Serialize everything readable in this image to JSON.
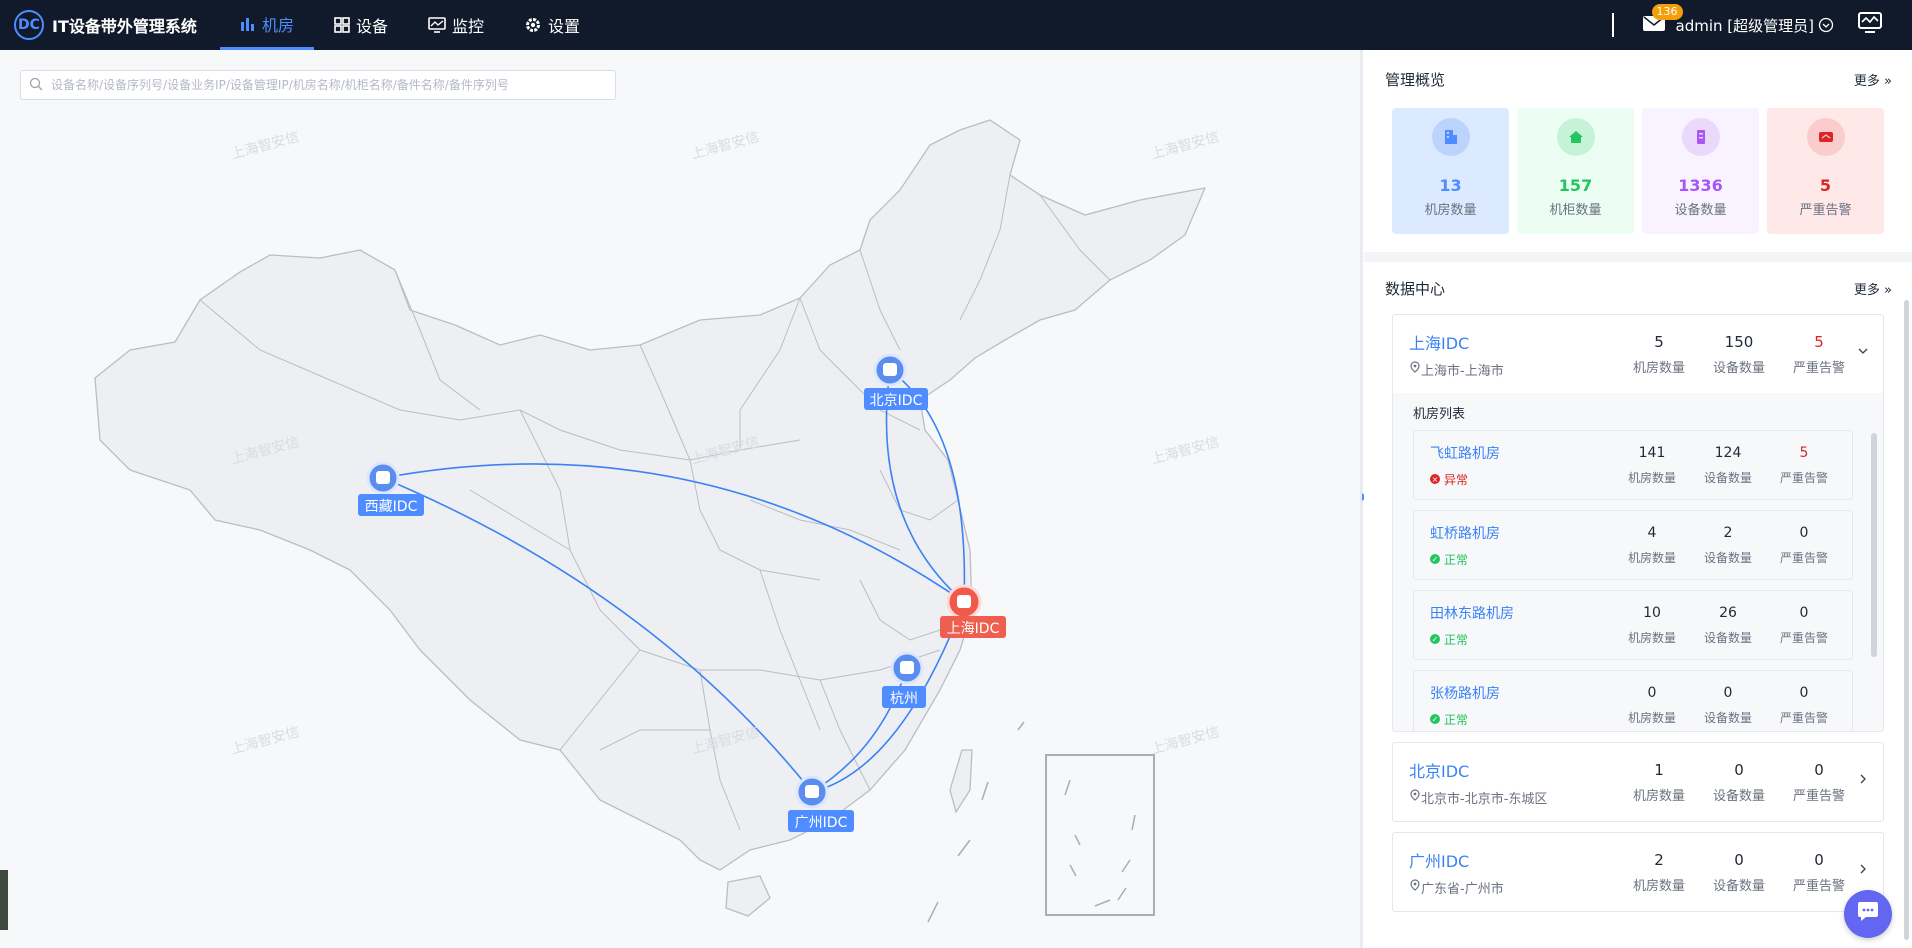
{
  "app": {
    "title": "IT设备带外管理系统",
    "logo_text": "DC"
  },
  "nav": {
    "items": [
      {
        "label": "机房",
        "icon": "bar-chart-icon",
        "active": true
      },
      {
        "label": "设备",
        "icon": "grid-icon",
        "active": false
      },
      {
        "label": "监控",
        "icon": "monitor-icon",
        "active": false
      },
      {
        "label": "设置",
        "icon": "gear-icon",
        "active": false
      }
    ]
  },
  "header": {
    "mail_count": "136",
    "user": "admin [超级管理员]"
  },
  "search": {
    "placeholder": "设备名称/设备序列号/设备业务IP/设备管理IP/机房名称/机柜名称/备件名称/备件序列号"
  },
  "map": {
    "nodes": {
      "beijing": "北京IDC",
      "tibet": "西藏IDC",
      "shanghai": "上海IDC",
      "hangzhou": "杭州",
      "guangzhou": "广州IDC"
    },
    "watermark": "上海智安信"
  },
  "overview": {
    "title": "管理概览",
    "more": "更多",
    "stats": [
      {
        "value": "13",
        "label": "机房数量",
        "color": "#4f8cff",
        "bg": "#dbeafe"
      },
      {
        "value": "157",
        "label": "机柜数量",
        "color": "#22c55e",
        "bg": "#ecfdf3"
      },
      {
        "value": "1336",
        "label": "设备数量",
        "color": "#a855f7",
        "bg": "#f8f3fe"
      },
      {
        "value": "5",
        "label": "严重告警",
        "color": "#dc2626",
        "bg": "#fee8e8"
      }
    ]
  },
  "datacenter": {
    "title": "数据中心",
    "more": "更多",
    "labels": {
      "rooms": "机房数量",
      "devices": "设备数量",
      "alarms": "严重告警"
    },
    "room_list_title": "机房列表",
    "items": [
      {
        "name": "上海IDC",
        "address": "上海市-上海市",
        "rooms": "5",
        "devices": "150",
        "alarms": "5",
        "expanded": true,
        "room_list": [
          {
            "name": "飞虹路机房",
            "status": "异常",
            "ok": false,
            "rooms": "141",
            "devices": "124",
            "alarms": "5"
          },
          {
            "name": "虹桥路机房",
            "status": "正常",
            "ok": true,
            "rooms": "4",
            "devices": "2",
            "alarms": "0"
          },
          {
            "name": "田林东路机房",
            "status": "正常",
            "ok": true,
            "rooms": "10",
            "devices": "26",
            "alarms": "0"
          },
          {
            "name": "张杨路机房",
            "status": "正常",
            "ok": true,
            "rooms": "0",
            "devices": "0",
            "alarms": "0"
          }
        ]
      },
      {
        "name": "北京IDC",
        "address": "北京市-北京市-东城区",
        "rooms": "1",
        "devices": "0",
        "alarms": "0",
        "expanded": false
      },
      {
        "name": "广州IDC",
        "address": "广东省-广州市",
        "rooms": "2",
        "devices": "0",
        "alarms": "0",
        "expanded": false
      }
    ]
  },
  "colors": {
    "accent": "#4f8cff",
    "topbar": "#111a2b",
    "danger": "#dc2626",
    "success": "#22c55e"
  }
}
